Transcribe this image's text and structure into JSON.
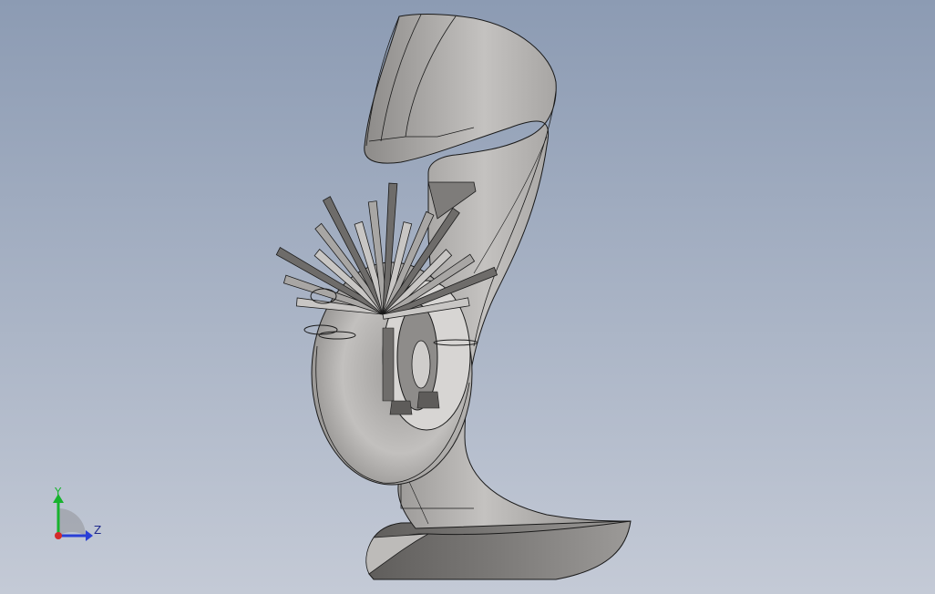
{
  "viewport": {
    "background_top": "#8c9bb3",
    "background_bottom": "#c4cad6"
  },
  "model": {
    "shade_light": "#c8c6c4",
    "shade_mid": "#a8a6a4",
    "shade_dark": "#6e6c6a",
    "edge_color": "#1a1a1a"
  },
  "triad": {
    "y_label": "Y",
    "z_label": "Z",
    "y_color": "#17b32e",
    "z_color": "#2a3fd6",
    "x_color": "#d42a2a",
    "label_color": "#1f2a8c"
  }
}
